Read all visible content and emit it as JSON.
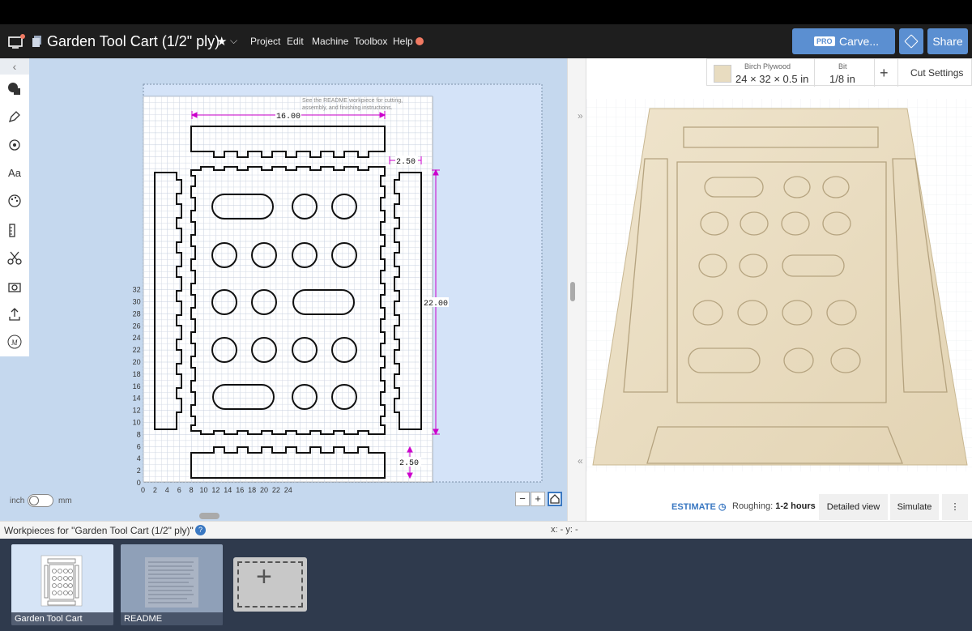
{
  "header": {
    "title": "Garden Tool Cart (1/2\" ply)",
    "menu": [
      "Project",
      "Edit",
      "Machine",
      "Toolbox",
      "Help"
    ],
    "pro_badge": "PRO",
    "carve_label": "Carve...",
    "share_label": "Share"
  },
  "left_panel": {
    "toolbar_icons": [
      "shape-icon",
      "pen-icon",
      "target-icon",
      "text-icon",
      "palette-icon",
      "ruler-icon",
      "scissors-icon",
      "camera-icon",
      "upload-icon",
      "m-icon"
    ],
    "text_tool_label": "Aa",
    "units": {
      "left": "inch",
      "right": "mm"
    },
    "zoom_minus": "−",
    "zoom_plus": "+",
    "readme_note_line1": "See the README workpiece for cutting,",
    "readme_note_line2": "assembly, and finishing instructions.",
    "x_ticks": [
      "0",
      "2",
      "4",
      "6",
      "8",
      "10",
      "12",
      "14",
      "16",
      "18",
      "20",
      "22",
      "24"
    ],
    "y_ticks": [
      "0",
      "2",
      "4",
      "6",
      "8",
      "10",
      "12",
      "14",
      "16",
      "18",
      "20",
      "22",
      "24",
      "26",
      "28",
      "30",
      "32"
    ],
    "dimensions": {
      "top_width": "16.00",
      "side_width": "2.50",
      "height": "22.00",
      "bottom_width": "2.50"
    }
  },
  "right_panel": {
    "material_name": "Birch Plywood",
    "material_size": "24 × 32 × 0.5 in",
    "bit_label": "Bit",
    "bit_value": "1/8 in",
    "add_label": "+",
    "cut_settings_label": "Cut Settings",
    "estimate_label": "ESTIMATE",
    "roughing_label": "Roughing:",
    "roughing_value": "1-2 hours",
    "detailed_view_label": "Detailed view",
    "simulate_label": "Simulate",
    "more_label": "⋮"
  },
  "bottom": {
    "workpieces_label": "Workpieces for \"Garden Tool Cart (1/2\" ply)\"",
    "help_label": "?",
    "coords": "x: - y: -",
    "cards": [
      "Garden Tool Cart",
      "README"
    ]
  },
  "colors": {
    "accent": "#5b8fd1",
    "canvas_bg": "#c5d8ee",
    "dimension": "#cc00cc",
    "wood": "#e8dcc0"
  }
}
